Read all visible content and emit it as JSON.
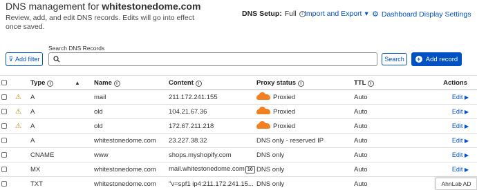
{
  "header": {
    "title_prefix": "DNS management for ",
    "domain": "whitestonedome.com",
    "subtitle": "Review, add, and edit DNS records. Edits will go into effect once saved."
  },
  "toolbar": {
    "dns_setup_label": "DNS Setup:",
    "dns_setup_value": "Full",
    "import_export": "Import and Export",
    "dashboard_settings": "Dashboard Display Settings"
  },
  "search": {
    "label": "Search DNS Records",
    "placeholder": "",
    "filter_button": "Add filter",
    "search_button": "Search",
    "add_record_button": "Add record"
  },
  "table": {
    "columns": {
      "type": "Type",
      "name": "Name",
      "content": "Content",
      "proxy": "Proxy status",
      "ttl": "TTL",
      "actions": "Actions"
    },
    "edit_label": "Edit",
    "rows": [
      {
        "warn": true,
        "type": "A",
        "name": "mail",
        "content": "211.172.241.155",
        "proxied": true,
        "proxy": "Proxied",
        "ttl": "Auto"
      },
      {
        "warn": true,
        "type": "A",
        "name": "old",
        "content": "104.21.67.36",
        "proxied": true,
        "proxy": "Proxied",
        "ttl": "Auto"
      },
      {
        "warn": true,
        "type": "A",
        "name": "old",
        "content": "172.67.211.218",
        "proxied": true,
        "proxy": "Proxied",
        "ttl": "Auto"
      },
      {
        "warn": false,
        "type": "A",
        "name": "whitestonedome.com",
        "content": "23.227.38.32",
        "proxied": false,
        "proxy": "DNS only - reserved IP",
        "ttl": "Auto"
      },
      {
        "warn": false,
        "type": "CNAME",
        "name": "www",
        "content": "shops.myshopify.com",
        "proxied": false,
        "proxy": "DNS only",
        "ttl": "Auto"
      },
      {
        "warn": false,
        "type": "MX",
        "name": "whitestonedome.com",
        "content": "mail.whitestonedome.com",
        "badge": "10",
        "proxied": false,
        "proxy": "DNS only",
        "ttl": "Auto"
      },
      {
        "warn": false,
        "type": "TXT",
        "name": "whitestonedome.com",
        "content": "\"v=spf1 ip4:211.172.241.15...",
        "proxied": false,
        "proxy": "DNS only",
        "ttl": "Auto"
      }
    ]
  },
  "overlay": {
    "ahnlab": "AhnLab AD"
  },
  "colors": {
    "accent": "#0051c3",
    "proxied": "#f38020",
    "warning": "#b8860b"
  }
}
